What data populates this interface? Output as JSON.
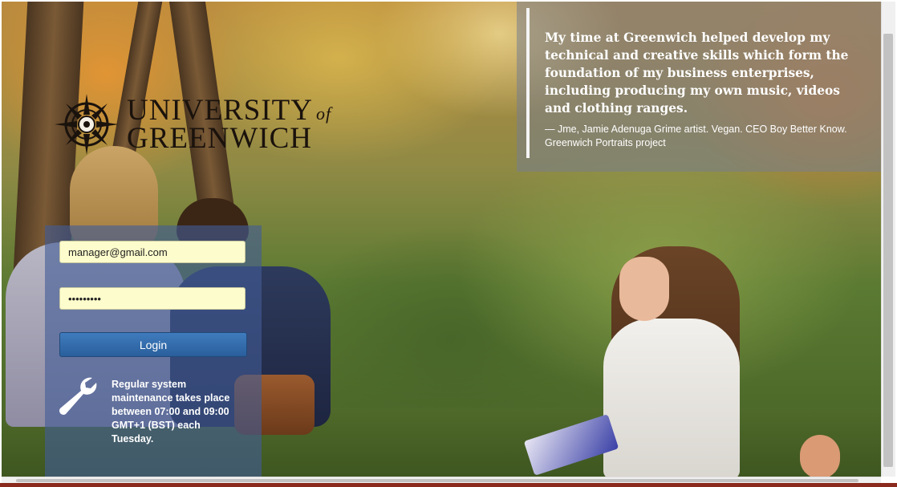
{
  "brand": {
    "line1": "UNIVERSITY",
    "of": "of",
    "line2": "GREENWICH"
  },
  "quote": {
    "text": "My time at Greenwich helped develop my technical and creative skills which form the foundation of my business enterprises, including producing my own music, videos and clothing ranges.",
    "citation": "— Jme, Jamie Adenuga Grime artist. Vegan. CEO Boy Better Know. Greenwich Portraits project"
  },
  "login": {
    "email_value": "manager@gmail.com",
    "password_value": "•••••••••",
    "button_label": "Login"
  },
  "maintenance": {
    "icon": "wrench-icon",
    "text": "Regular system maintenance takes place between 07:00 and 09:00 GMT+1 (BST) each Tuesday."
  },
  "colors": {
    "login_button": "#2a5f9c",
    "field_background": "#fdfccc",
    "login_panel": "#425c96"
  }
}
